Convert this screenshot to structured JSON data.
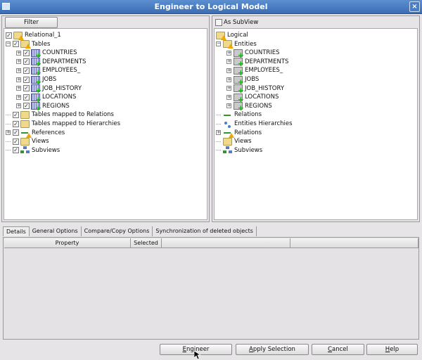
{
  "window": {
    "title": "Engineer to Logical Model",
    "close": "×"
  },
  "left": {
    "filter_label": "Filter",
    "tree": [
      {
        "label": "Relational_1",
        "level": 0,
        "icon": "folder warn",
        "checked": true,
        "expander": "none"
      },
      {
        "label": "Tables",
        "level": 0,
        "icon": "folder warn",
        "checked": true,
        "expander": "minus"
      },
      {
        "label": "COUNTRIES",
        "level": 1,
        "icon": "table plus",
        "checked": true,
        "expander": "plus"
      },
      {
        "label": "DEPARTMENTS",
        "level": 1,
        "icon": "table plus",
        "checked": true,
        "expander": "plus"
      },
      {
        "label": "EMPLOYEES_",
        "level": 1,
        "icon": "table plus",
        "checked": true,
        "expander": "plus"
      },
      {
        "label": "JOBS",
        "level": 1,
        "icon": "table plus",
        "checked": true,
        "expander": "plus"
      },
      {
        "label": "JOB_HISTORY",
        "level": 1,
        "icon": "table plus",
        "checked": true,
        "expander": "plus"
      },
      {
        "label": "LOCATIONS",
        "level": 1,
        "icon": "table plus",
        "checked": true,
        "expander": "plus"
      },
      {
        "label": "REGIONS",
        "level": 1,
        "icon": "table plus",
        "checked": true,
        "expander": "plus"
      },
      {
        "label": "Tables mapped to Relations",
        "level": 0,
        "icon": "folder",
        "checked": true,
        "expander": "line"
      },
      {
        "label": "Tables mapped to Hierarchies",
        "level": 0,
        "icon": "folder",
        "checked": true,
        "expander": "line"
      },
      {
        "label": "References",
        "level": 0,
        "icon": "rel warn",
        "checked": true,
        "expander": "plus"
      },
      {
        "label": "Views",
        "level": 0,
        "icon": "folder",
        "checked": true,
        "expander": "line"
      },
      {
        "label": "Subviews",
        "level": 0,
        "icon": "sub",
        "checked": true,
        "expander": "line"
      }
    ]
  },
  "right": {
    "as_subview_label": "As SubView",
    "as_subview_checked": false,
    "tree": [
      {
        "label": "Logical",
        "level": 0,
        "icon": "folder warn",
        "expander": "none"
      },
      {
        "label": "Entities",
        "level": 0,
        "icon": "folder warn",
        "expander": "minus"
      },
      {
        "label": "COUNTRIES",
        "level": 1,
        "icon": "entity plus",
        "expander": "plus"
      },
      {
        "label": "DEPARTMENTS",
        "level": 1,
        "icon": "entity plus",
        "expander": "plus"
      },
      {
        "label": "EMPLOYEES_",
        "level": 1,
        "icon": "entity plus",
        "expander": "plus"
      },
      {
        "label": "JOBS",
        "level": 1,
        "icon": "entity plus",
        "expander": "plus"
      },
      {
        "label": "JOB_HISTORY",
        "level": 1,
        "icon": "entity plus",
        "expander": "plus"
      },
      {
        "label": "LOCATIONS",
        "level": 1,
        "icon": "entity plus",
        "expander": "plus"
      },
      {
        "label": "REGIONS",
        "level": 1,
        "icon": "entity plus",
        "expander": "plus"
      },
      {
        "label": "Relations",
        "level": 0,
        "icon": "rel",
        "expander": "line"
      },
      {
        "label": "Entities Hierarchies",
        "level": 0,
        "icon": "hier",
        "expander": "line"
      },
      {
        "label": "Relations",
        "level": 0,
        "icon": "rel warn",
        "expander": "plus"
      },
      {
        "label": "Views",
        "level": 0,
        "icon": "folder",
        "expander": "line"
      },
      {
        "label": "Subviews",
        "level": 0,
        "icon": "sub",
        "expander": "line"
      }
    ]
  },
  "tabs": [
    "Details",
    "General Options",
    "Compare/Copy Options",
    "Synchronization of deleted objects"
  ],
  "active_tab": 0,
  "table": {
    "columns": [
      "Property",
      "Selected",
      "",
      ""
    ]
  },
  "buttons": {
    "engineer": "Engineer",
    "apply": "Apply Selection",
    "cancel": "Cancel",
    "help": "Help"
  }
}
